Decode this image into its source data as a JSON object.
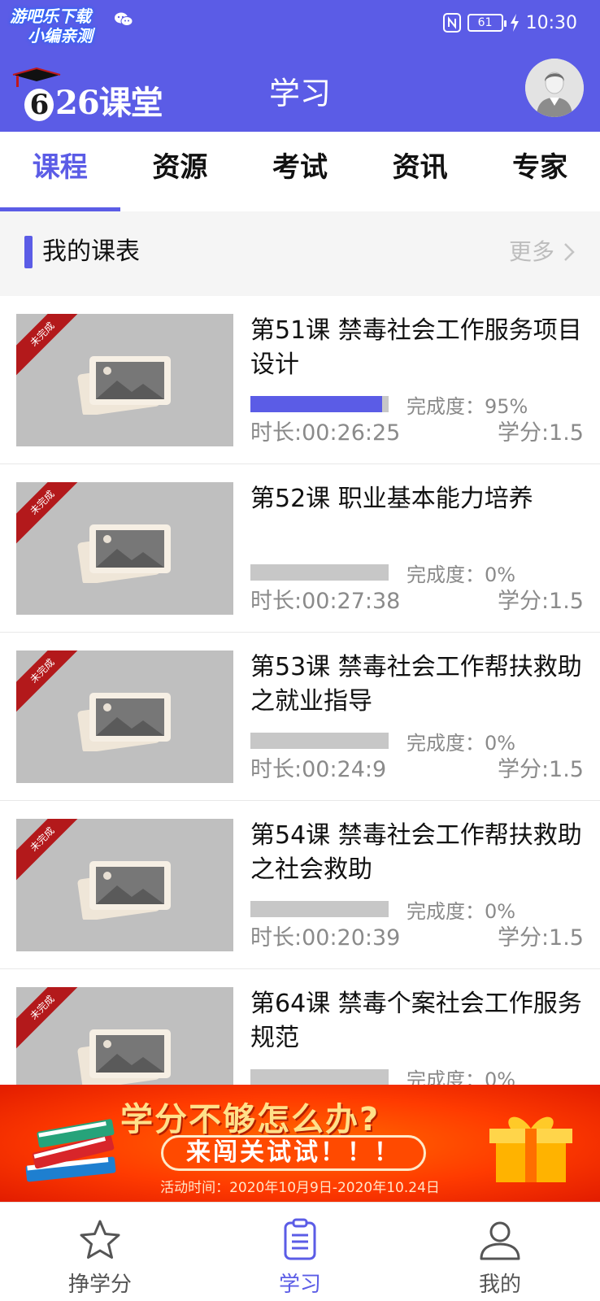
{
  "status_bar": {
    "watermark_line1": "游吧乐下载",
    "watermark_line2": "小编亲测",
    "battery": "61",
    "time": "10:30"
  },
  "header": {
    "logo_text": "626课堂",
    "title": "学习"
  },
  "tabs": [
    {
      "label": "课程",
      "active": true
    },
    {
      "label": "资源",
      "active": false
    },
    {
      "label": "考试",
      "active": false
    },
    {
      "label": "资讯",
      "active": false
    },
    {
      "label": "专家",
      "active": false
    }
  ],
  "section": {
    "title": "我的课表",
    "more": "更多"
  },
  "courses": [
    {
      "badge": "未完成",
      "title": "第51课  禁毒社会工作服务项目设计",
      "progress": 0.95,
      "progress_label": "完成度：95%",
      "duration": "时长:00:26:25",
      "credit": "学分:1.5"
    },
    {
      "badge": "未完成",
      "title": "第52课 职业基本能力培养",
      "progress": 0,
      "progress_label": "完成度：0%",
      "duration": "时长:00:27:38",
      "credit": "学分:1.5"
    },
    {
      "badge": "未完成",
      "title": "第53课 禁毒社会工作帮扶救助之就业指导",
      "progress": 0,
      "progress_label": "完成度：0%",
      "duration": "时长:00:24:9",
      "credit": "学分:1.5"
    },
    {
      "badge": "未完成",
      "title": "第54课 禁毒社会工作帮扶救助之社会救助",
      "progress": 0,
      "progress_label": "完成度：0%",
      "duration": "时长:00:20:39",
      "credit": "学分:1.5"
    },
    {
      "badge": "未完成",
      "title": "第64课 禁毒个案社会工作服务规范",
      "progress": 0,
      "progress_label": "完成度：0%",
      "duration": "",
      "credit": ""
    }
  ],
  "banner": {
    "title": "学分不够怎么办?",
    "cta": "来闯关试试！！！",
    "date": "活动时间：2020年10月9日-2020年10.24日"
  },
  "bottom_nav": [
    {
      "label": "挣学分",
      "icon": "star-icon",
      "active": false
    },
    {
      "label": "学习",
      "icon": "clipboard-icon",
      "active": true
    },
    {
      "label": "我的",
      "icon": "user-icon",
      "active": false
    }
  ],
  "colors": {
    "primary": "#5b5ce6",
    "ribbon": "#b3191b",
    "track": "#c7c7c7",
    "banner": "#ff3b00"
  }
}
